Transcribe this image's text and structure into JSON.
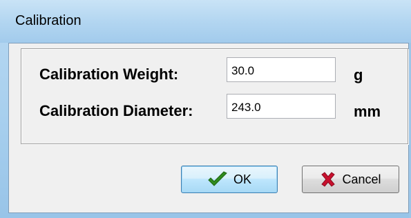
{
  "window": {
    "title": "Calibration"
  },
  "form": {
    "weight_label": "Calibration Weight:",
    "weight_value": "30.0",
    "weight_unit": "g",
    "diameter_label": "Calibration Diameter:",
    "diameter_value": "243.0",
    "diameter_unit": "mm"
  },
  "buttons": {
    "ok_label": "OK",
    "cancel_label": "Cancel"
  },
  "icons": {
    "ok": "checkmark-icon",
    "cancel": "x-icon"
  },
  "colors": {
    "ok_icon": "#2f8a1e",
    "cancel_icon": "#c8102e",
    "titlebar": "#b3d6f1"
  }
}
